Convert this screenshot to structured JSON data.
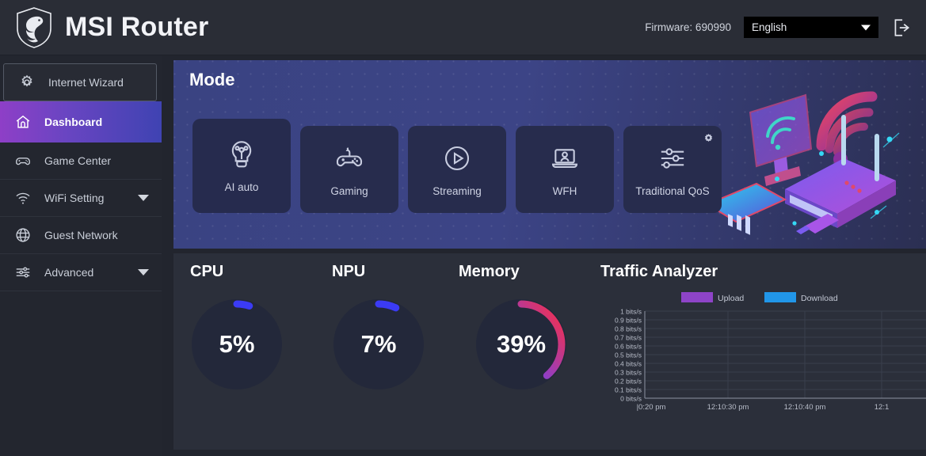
{
  "header": {
    "app_title": "MSI Router",
    "logo_icon": "msi-dragon-shield-logo",
    "firmware_label": "Firmware: 690990",
    "language_value": "English",
    "language_options": [
      "English"
    ],
    "logout_icon": "logout-icon"
  },
  "sidebar": {
    "items": [
      {
        "label": "Internet Wizard",
        "icon": "gear-icon",
        "active": false,
        "expandable": false
      },
      {
        "label": "Dashboard",
        "icon": "home-icon",
        "active": true,
        "expandable": false
      },
      {
        "label": "Game Center",
        "icon": "gamepad-icon",
        "active": false,
        "expandable": false
      },
      {
        "label": "WiFi Setting",
        "icon": "wifi-icon",
        "active": false,
        "expandable": true
      },
      {
        "label": "Guest Network",
        "icon": "globe-icon",
        "active": false,
        "expandable": false
      },
      {
        "label": "Advanced",
        "icon": "sliders-icon",
        "active": false,
        "expandable": true
      }
    ]
  },
  "mode": {
    "title": "Mode",
    "illustration_icon": "router-network-illustration",
    "cards": [
      {
        "label": "AI auto",
        "icon": "lightbulb-ai-icon",
        "selected": true
      },
      {
        "label": "Gaming",
        "icon": "gamepad-icon",
        "selected": false
      },
      {
        "label": "Streaming",
        "icon": "play-circle-icon",
        "selected": false
      },
      {
        "label": "WFH",
        "icon": "laptop-person-icon",
        "selected": false
      },
      {
        "label": "Traditional QoS",
        "icon": "sliders-icon",
        "selected": false,
        "badge_icon": "gear-icon"
      }
    ]
  },
  "stats": {
    "cpu": {
      "title": "CPU",
      "value": "5%",
      "percent": 5
    },
    "npu": {
      "title": "NPU",
      "value": "7%",
      "percent": 7
    },
    "memory": {
      "title": "Memory",
      "value": "39%",
      "percent": 39
    }
  },
  "traffic": {
    "title": "Traffic Analyzer"
  },
  "colors": {
    "accent_purple": "#8e44c8",
    "accent_blue": "#2196e8",
    "gauge_blue": "#3b3bf5",
    "gauge_pink": "#e6325e",
    "active_nav_start": "#8e3fc7",
    "active_nav_end": "#3f43b2"
  },
  "chart_data": {
    "type": "line",
    "title": "Traffic Analyzer",
    "xlabel": "",
    "ylabel": "",
    "grid": true,
    "legend_position": "top",
    "ylim": [
      0,
      1
    ],
    "y_ticks": [
      "0 bits/s",
      "0.1 bits/s",
      "0.2 bits/s",
      "0.3 bits/s",
      "0.4 bits/s",
      "0.5 bits/s",
      "0.6 bits/s",
      "0.7 bits/s",
      "0.8 bits/s",
      "0.9 bits/s",
      "1 bits/s"
    ],
    "x_ticks": [
      "|0:20 pm",
      "12:10:30 pm",
      "12:10:40 pm",
      "12:1"
    ],
    "series": [
      {
        "name": "Upload",
        "color": "#8e44c8",
        "values": []
      },
      {
        "name": "Download",
        "color": "#2196e8",
        "values": []
      }
    ]
  }
}
